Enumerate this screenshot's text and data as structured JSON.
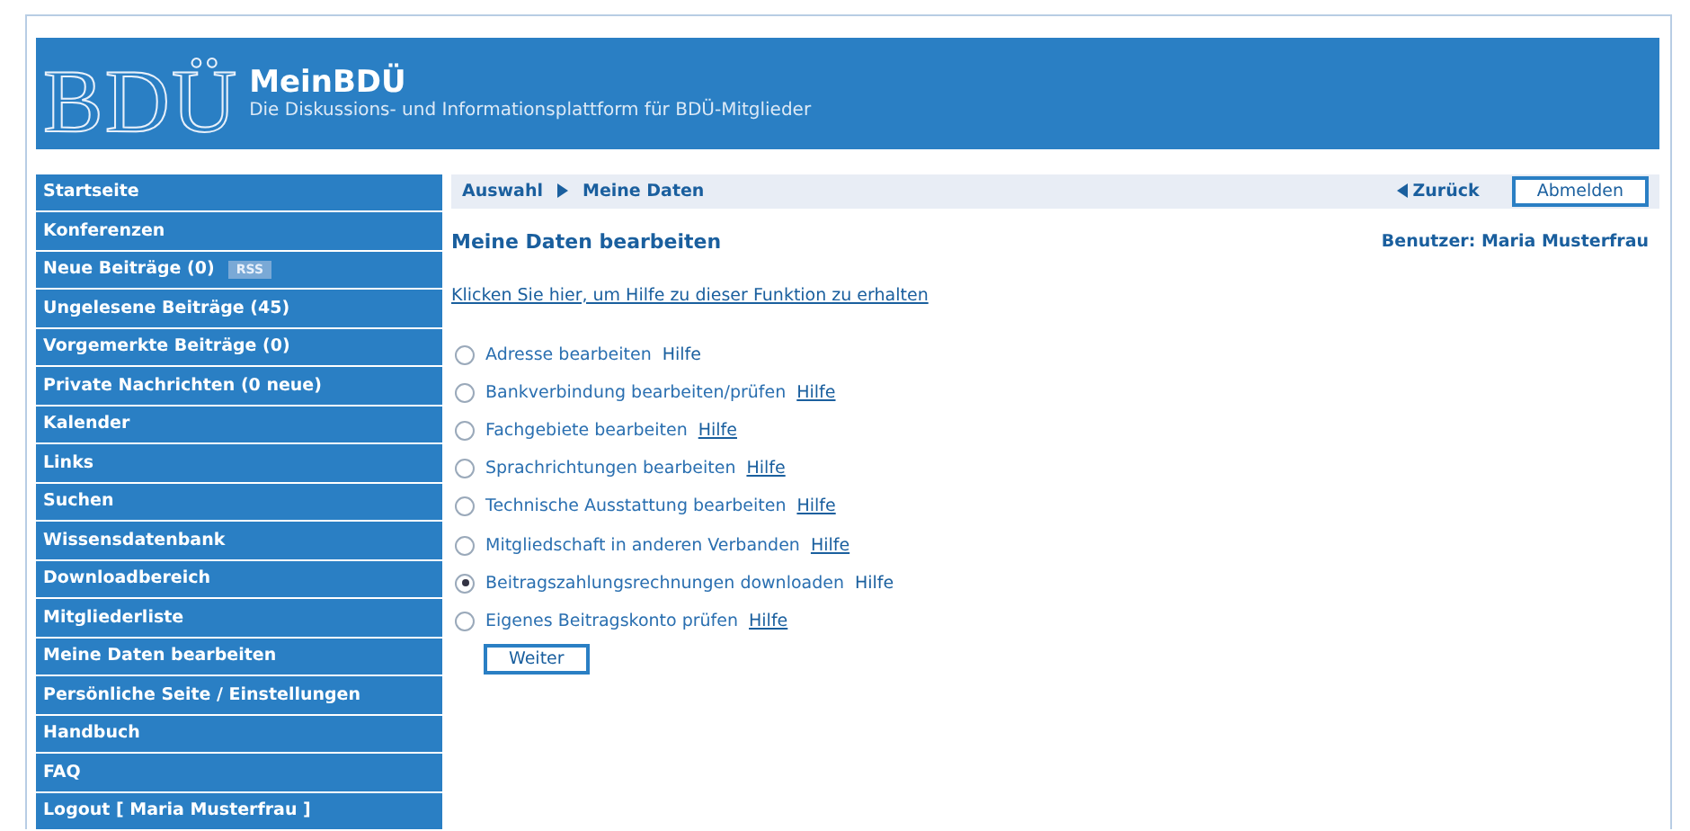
{
  "header": {
    "logo": "BDÜ",
    "title": "MeinBDÜ",
    "subtitle": "Die Diskussions- und Informationsplattform für BDÜ-Mitglieder"
  },
  "sidebar": {
    "items": [
      {
        "label": "Startseite"
      },
      {
        "label": "Konferenzen"
      },
      {
        "label": "Neue Beiträge (0)",
        "badge": "RSS"
      },
      {
        "label": "Ungelesene Beiträge (45)"
      },
      {
        "label": "Vorgemerkte Beiträge (0)"
      },
      {
        "label": "Private Nachrichten (0 neue)"
      },
      {
        "label": "Kalender"
      },
      {
        "label": "Links"
      },
      {
        "label": "Suchen"
      },
      {
        "label": "Wissensdatenbank"
      },
      {
        "label": "Downloadbereich"
      },
      {
        "label": "Mitgliederliste"
      },
      {
        "label": "Meine Daten bearbeiten"
      },
      {
        "label": "Persönliche Seite / Einstellungen"
      },
      {
        "label": "Handbuch"
      },
      {
        "label": "FAQ"
      },
      {
        "label": "Logout [ Maria Musterfrau ]"
      }
    ]
  },
  "breadcrumb": [
    "Auswahl",
    "Meine Daten"
  ],
  "back_link": "Zurück",
  "logout_button": "Abmelden",
  "heading": "Meine Daten bearbeiten",
  "user": "Benutzer: Maria Musterfrau",
  "help_link": "Klicken Sie hier, um Hilfe zu dieser Funktion zu erhalten",
  "options": [
    {
      "label": "Adresse bearbeiten",
      "help": "Hilfe",
      "help_underlined": false,
      "selected": false
    },
    {
      "label": "Bankverbindung bearbeiten/prüfen",
      "help": "Hilfe",
      "help_underlined": true,
      "selected": false
    },
    {
      "label": "Fachgebiete bearbeiten",
      "help": "Hilfe",
      "help_underlined": true,
      "selected": false
    },
    {
      "label": "Sprachrichtungen bearbeiten",
      "help": "Hilfe",
      "help_underlined": true,
      "selected": false
    },
    {
      "label": "Technische Ausstattung bearbeiten",
      "help": "Hilfe",
      "help_underlined": true,
      "selected": false
    },
    {
      "label": "Mitgliedschaft in anderen Verbanden",
      "help": "Hilfe",
      "help_underlined": true,
      "selected": false
    },
    {
      "label": "Beitragszahlungsrechnungen downloaden",
      "help": "Hilfe",
      "help_underlined": false,
      "selected": true
    },
    {
      "label": "Eigenes Beitragskonto prüfen",
      "help": "Hilfe",
      "help_underlined": true,
      "selected": false
    }
  ],
  "submit_button": "Weiter"
}
